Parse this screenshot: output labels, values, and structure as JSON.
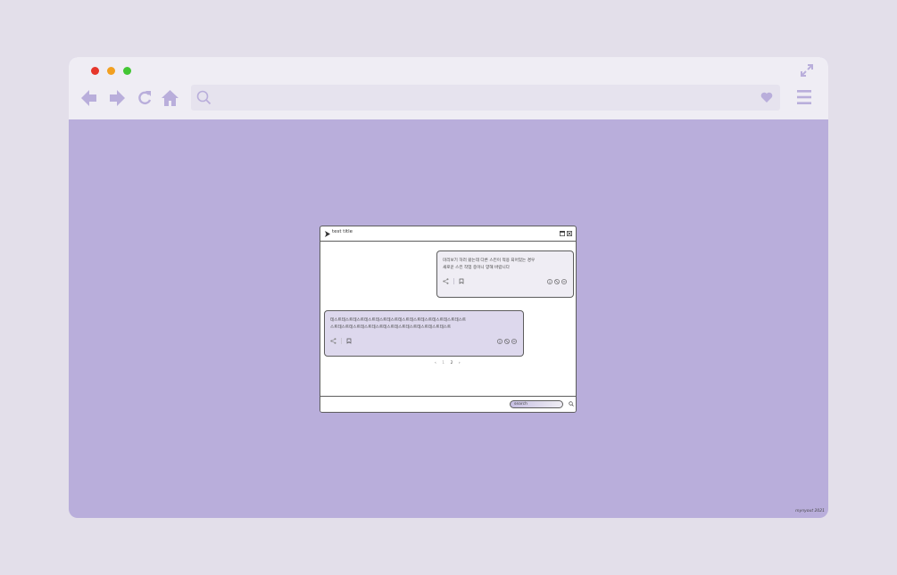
{
  "browser": {
    "colors": {
      "frame": "#efedf4",
      "content": "#b9aedb",
      "icon": "#b9aedb",
      "outline": "#5d5d5d"
    },
    "traffic_lights": [
      "close",
      "minimize",
      "maximize"
    ],
    "nav_icons": [
      "back-arrow-icon",
      "forward-arrow-icon",
      "reload-icon",
      "home-icon"
    ],
    "address": {
      "value": ""
    }
  },
  "app": {
    "title": "test title",
    "cards": [
      {
        "text": "미리보기 하러 왔는데 다른 스킨이 적용 되어있는 경우\n새로운 스킨 작업 중이니 양해 바랍니다",
        "actions": [
          "info-icon",
          "forbidden-icon",
          "minus-icon"
        ]
      },
      {
        "text": "테스트테스트테스트테스트테스트테스트테스트테스트테스트테스트테스트테스트\n스트테스트테스트테스트테스트테스트테스트테스트테스트테스트테스트",
        "actions": [
          "info-icon",
          "forbidden-icon",
          "minus-icon"
        ]
      }
    ],
    "pager": {
      "prev": "‹",
      "pages": [
        "1",
        "2"
      ],
      "current": "2",
      "next": "›"
    },
    "search": {
      "placeholder": "search"
    }
  },
  "credit": "mynyout 2021"
}
